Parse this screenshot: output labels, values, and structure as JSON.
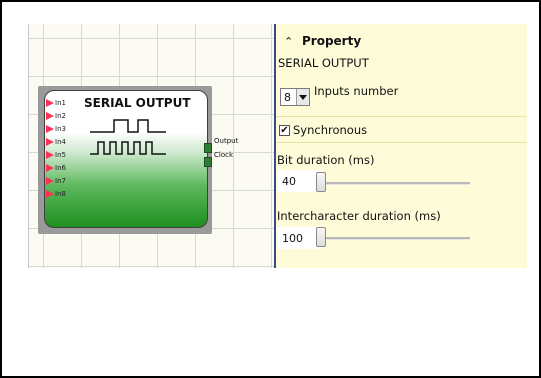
{
  "block": {
    "title": "SERIAL OUTPUT",
    "inputs": [
      "In1",
      "In2",
      "In3",
      "In4",
      "In5",
      "In6",
      "In7",
      "In8"
    ],
    "outputs": {
      "output": "Output",
      "clock": "Clock"
    }
  },
  "panel": {
    "header": "Property",
    "subtitle": "SERIAL OUTPUT",
    "inputs_number": {
      "value": "8",
      "label": "Inputs number"
    },
    "synchronous": {
      "label": "Synchronous",
      "checked": true,
      "mark": "✔"
    },
    "bit_duration": {
      "label": "Bit duration (ms)",
      "value": "40"
    },
    "intercharacter_duration": {
      "label": "Intercharacter duration (ms)",
      "value": "100"
    }
  },
  "colors": {
    "panel_bg": "#fefcd8",
    "input_pin": "#ff3355",
    "block_green": "#1f8f1f",
    "output_pin": "#2e7d32"
  },
  "icons": {
    "collapse": "caret-up-icon",
    "dropdown": "chevron-down-icon",
    "input_pin": "triangle-right-icon"
  }
}
